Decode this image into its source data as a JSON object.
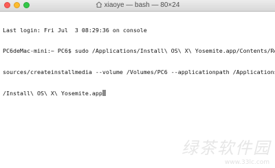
{
  "window": {
    "title": "xiaoye — bash — 80×24",
    "title_icon": "home-icon"
  },
  "terminal": {
    "lines": [
      "Last login: Fri Jul  3 08:29:36 on console",
      "PC6deMac-mini:~ PC6$ sudo /Applications/Install\\ OS\\ X\\ Yosemite.app/Contents/Re",
      "sources/createinstallmedia --volume /Volumes/PC6 --applicationpath /Applications",
      "/Install\\ OS\\ X\\ Yosemite.app"
    ]
  },
  "watermark": {
    "text": "绿茶软件园",
    "url": "www.33lc.com"
  },
  "colors": {
    "close": "#fc5c56",
    "minimize": "#fdbc2e",
    "zoom": "#33c748"
  }
}
